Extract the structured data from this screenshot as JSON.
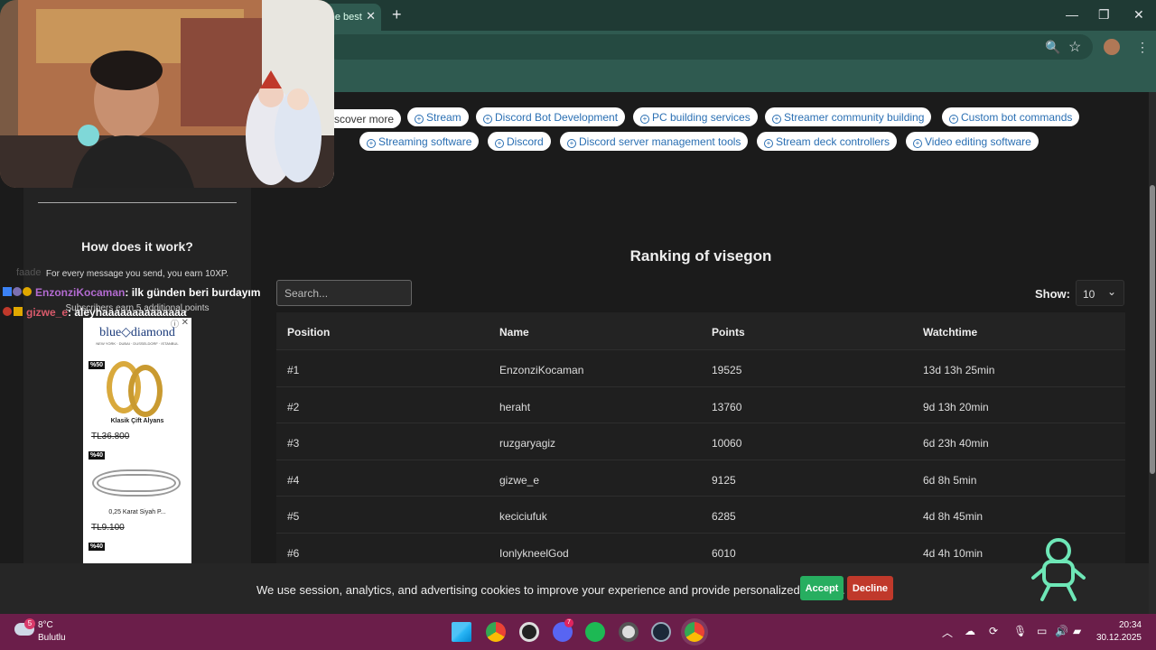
{
  "browser": {
    "tab_title": "The best",
    "tab_close": "✕",
    "new_tab": "+",
    "minimize": "—",
    "maximize": "❐",
    "close": "✕",
    "zoom_icon": "🔍",
    "star_icon": "☆",
    "menu_icon": "⋮"
  },
  "tags": {
    "discover_more": "scover more",
    "row1": [
      "Stream",
      "Discord Bot Development",
      "PC building services",
      "Streamer community building",
      "Custom bot commands"
    ],
    "row2": [
      "Streaming software",
      "Discord",
      "Discord server management tools",
      "Stream deck controllers",
      "Video editing software"
    ]
  },
  "sidebar": {
    "title": "How does it work?",
    "line1": "For every message you send, you earn 10XP.",
    "line2": "Subscribers earn 5 additional points"
  },
  "ad": {
    "brand": "blue◇diamond",
    "cities": "NEW YORK · DUBAI · DUSSELDORF · ISTANBUL",
    "badge1": "%50",
    "label1": "Klasik Çift Alyans",
    "price1": "TL36.800",
    "badge2": "%40",
    "label2": "0,25 Karat Siyah P...",
    "price2": "TL9.100",
    "badge3": "%40",
    "close": "✕",
    "adchoice": "ⓘ"
  },
  "chat": {
    "ghost": "faade",
    "user1": "EnzonziKocaman",
    "msg1": ": ilk günden beri burdayım",
    "user2": "gizwe_e",
    "msg2": ": aleyhaaaaaaaaaaaaaa"
  },
  "ranking": {
    "title": "Ranking of visegon",
    "search_placeholder": "Search...",
    "show_label": "Show:",
    "show_value": "10",
    "columns": [
      "Position",
      "Name",
      "Points",
      "Watchtime"
    ],
    "rows": [
      [
        "#1",
        "EnzonziKocaman",
        "19525",
        "13d 13h 25min"
      ],
      [
        "#2",
        "heraht",
        "13760",
        "9d 13h 20min"
      ],
      [
        "#3",
        "ruzgaryagiz",
        "10060",
        "6d 23h 40min"
      ],
      [
        "#4",
        "gizwe_e",
        "9125",
        "6d 8h 5min"
      ],
      [
        "#5",
        "keciciufuk",
        "6285",
        "4d 8h 45min"
      ],
      [
        "#6",
        "IonlykneelGod",
        "6010",
        "4d 4h 10min"
      ]
    ]
  },
  "cookie": {
    "text": "We use session, analytics, and advertising cookies to improve your experience and provide personalized content.",
    "accept": "Accept",
    "decline": "Decline"
  },
  "taskbar": {
    "weather_badge": "5",
    "temperature": "8°C",
    "weather": "Bulutlu",
    "time": "20:34",
    "date": "30.12.2025",
    "discord_badge": "7"
  },
  "colors": {
    "accent_green": "#27ae60",
    "decline_red": "#c0392b",
    "tag_blue": "#2a6fb3",
    "taskbar": "#6b1e4a"
  }
}
